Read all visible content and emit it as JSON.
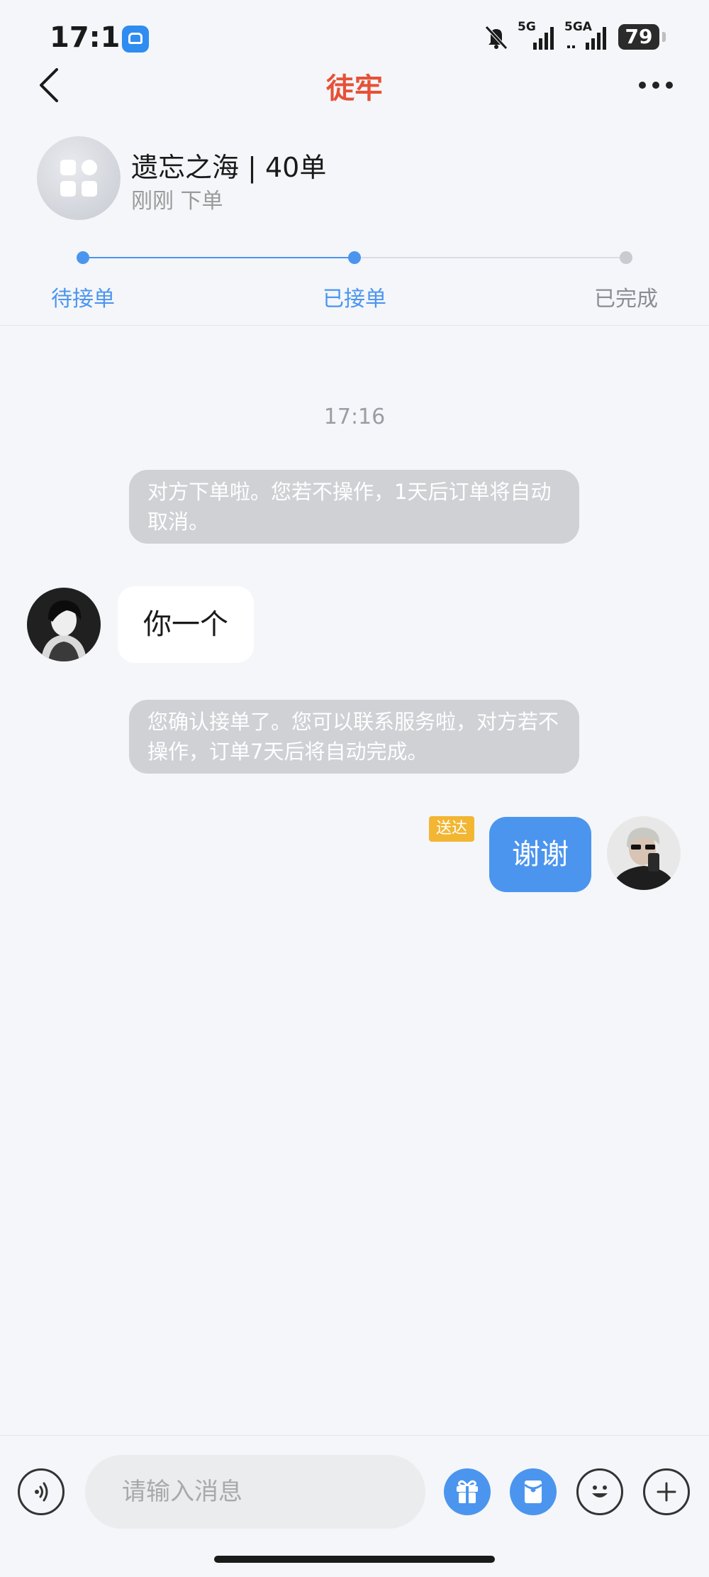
{
  "status_bar": {
    "time": "17:16",
    "battery": "79",
    "network_1": "5G",
    "network_2": "5GA"
  },
  "header": {
    "title": "徒牢"
  },
  "order": {
    "name": "遗忘之海 | 40单",
    "subtitle": "刚刚 下单"
  },
  "progress": {
    "steps": [
      "待接单",
      "已接单",
      "已完成"
    ],
    "current_step": 2,
    "active_color": "#4b95ef",
    "inactive_color": "#c8cbd0"
  },
  "chat": {
    "time_divider": "17:16",
    "system_message_1": "对方下单啦。您若不操作，1天后订单将自动取消。",
    "incoming_text": "你一个",
    "system_message_2": "您确认接单了。您可以联系服务啦，对方若不操作，订单7天后将自动完成。",
    "outgoing_text": "谢谢",
    "delivered_badge": "送达"
  },
  "input": {
    "placeholder": "请输入消息"
  },
  "icons": {
    "voice": "voice-icon",
    "gift": "gift-icon",
    "red_packet": "red-packet-icon",
    "emoji": "emoji-icon",
    "plus": "plus-icon"
  },
  "colors": {
    "title": "#e65137",
    "accent": "#4b95ef",
    "badge": "#f2b633"
  }
}
